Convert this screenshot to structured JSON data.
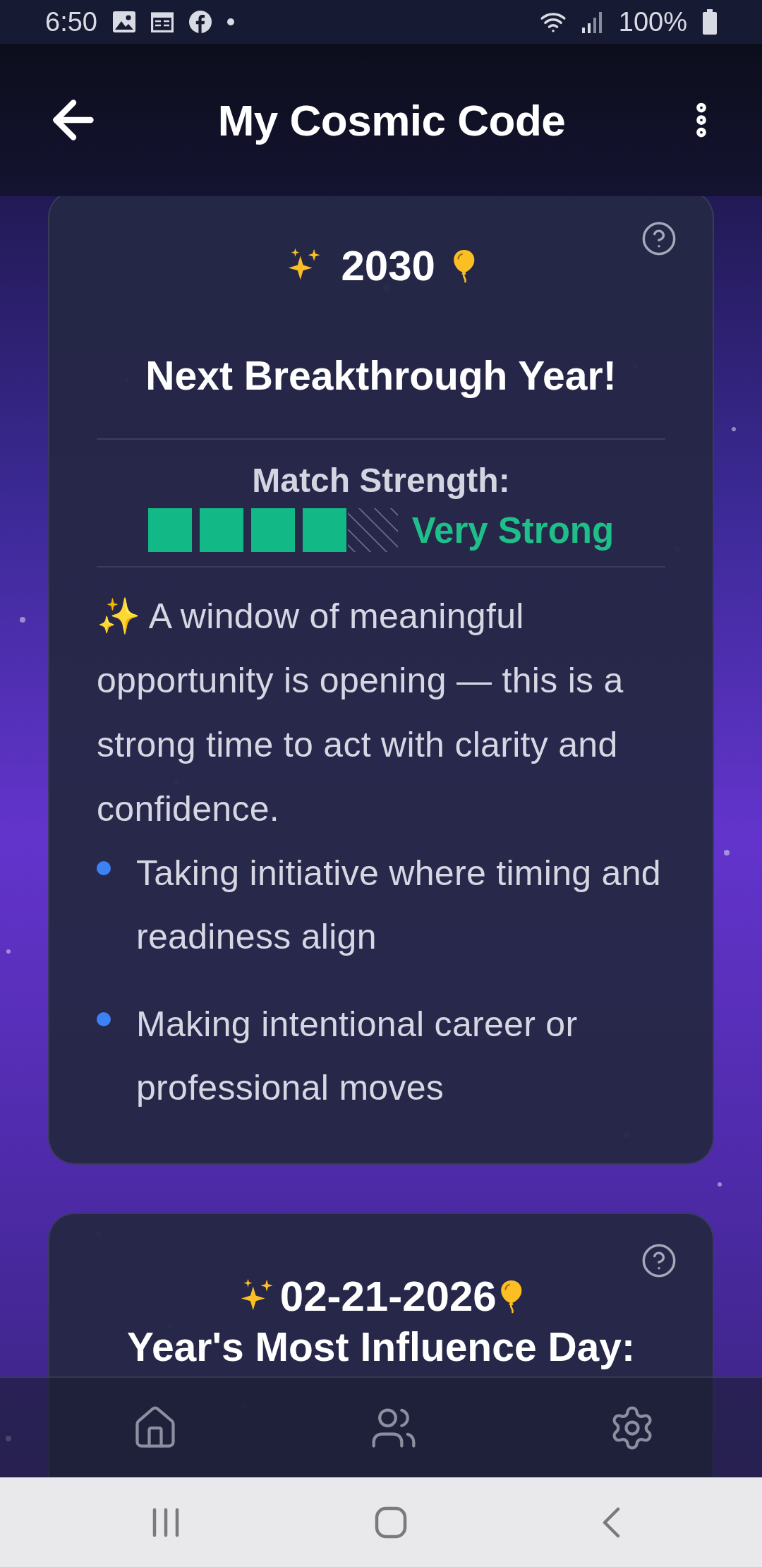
{
  "status_bar": {
    "time": "6:50",
    "battery": "100%"
  },
  "app_bar": {
    "title": "My Cosmic Code"
  },
  "cards": [
    {
      "date": "2030",
      "title": "Next Breakthrough Year!",
      "strength": {
        "label": "Match Strength:",
        "level": 0.8,
        "value": "Very Strong"
      },
      "description": "✨ A window of meaningful opportunity is opening — this is a strong time to act with clarity and confidence.",
      "points": [
        "Taking initiative where timing and readiness align",
        "Making intentional career or professional moves"
      ]
    },
    {
      "date": "02-21-2026",
      "title": "Year's Most Influence Day:"
    }
  ],
  "bottom_nav": [
    {
      "kind": "home"
    },
    {
      "kind": "people"
    },
    {
      "kind": "settings"
    }
  ]
}
